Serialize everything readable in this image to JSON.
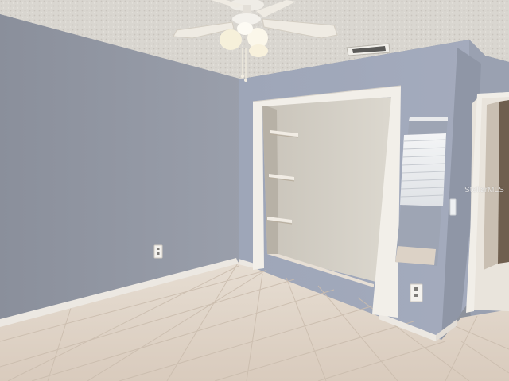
{
  "watermark": "StellarMLS"
}
